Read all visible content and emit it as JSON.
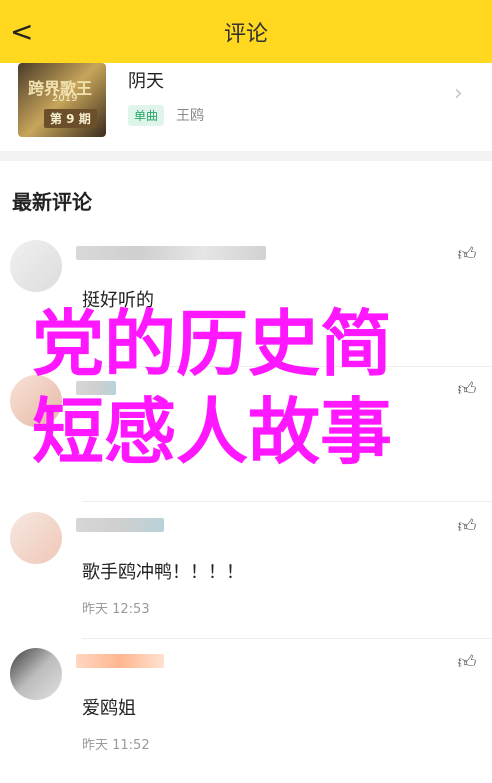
{
  "header": {
    "back_glyph": "<",
    "title": "评论"
  },
  "song": {
    "cover_text_1": "跨界歌王",
    "cover_text_2": "2019",
    "cover_text_3": "第 9 期",
    "title": "阴天",
    "tag": "单曲",
    "artist": "王鸥",
    "chevron": "›"
  },
  "section_title": "最新评论",
  "comments": [
    {
      "text": "挺好听的",
      "time": ""
    },
    {
      "text": "",
      "time": ""
    },
    {
      "text": "歌手鸥冲鸭！！！！",
      "time": "昨天 12:53"
    },
    {
      "text": "爱鸥姐",
      "time": "昨天 11:52"
    }
  ],
  "icons": {
    "like": "thumbs-up-icon"
  },
  "overlay": {
    "line1": "党的历史简",
    "line2": "短感人故事"
  },
  "colors": {
    "header_bg": "#ffd81f",
    "overlay": "#ff17ff",
    "tag_green": "#2aa46a"
  }
}
